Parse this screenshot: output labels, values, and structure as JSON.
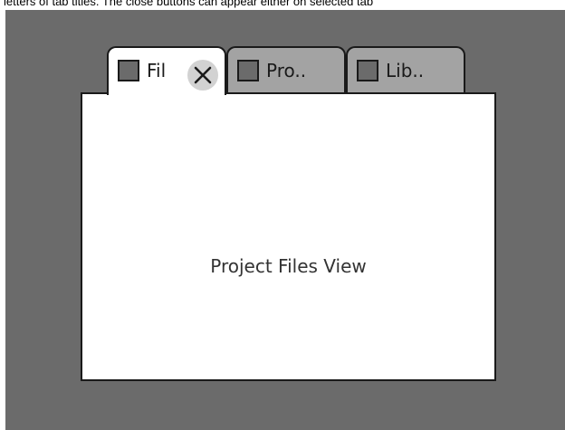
{
  "caption": "letters of tab titles. The close buttons can appear either on selected tab",
  "tabs": [
    {
      "label": "Fil",
      "state": "active",
      "icon": "square-icon"
    },
    {
      "label": "Pro..",
      "state": "inactive",
      "icon": "square-icon"
    },
    {
      "label": "Lib..",
      "state": "inactive",
      "icon": "square-icon"
    }
  ],
  "close_button": {
    "icon": "close-icon"
  },
  "panel": {
    "title": "Project Files View"
  },
  "colors": {
    "background": "#6b6b6b",
    "active_tab": "#ffffff",
    "inactive_tab": "#a3a3a3",
    "border": "#1a1a1a",
    "close_button": "#d2d2d2"
  }
}
